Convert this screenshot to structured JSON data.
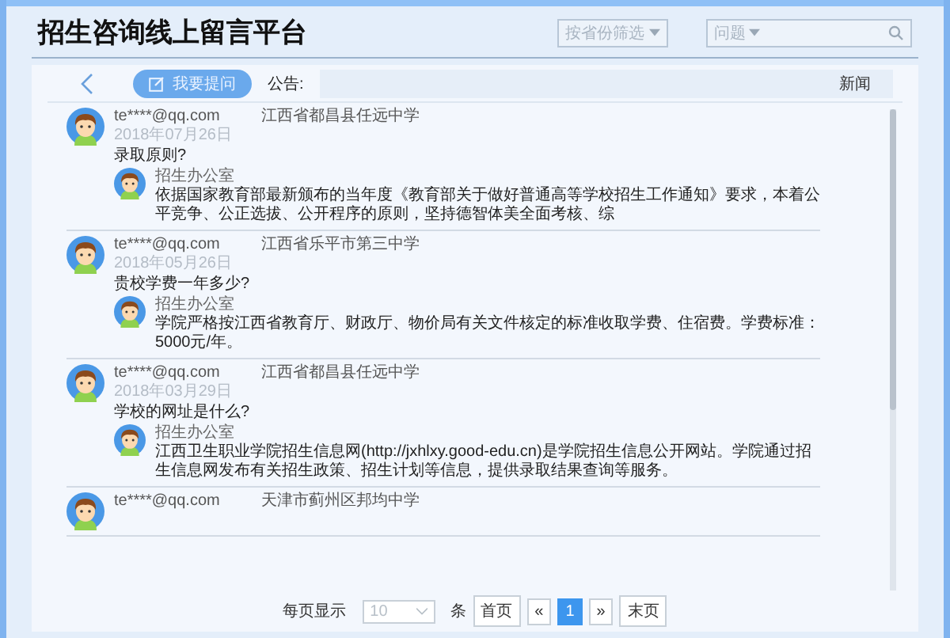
{
  "header": {
    "title": "招生咨询线上留言平台",
    "filter": {
      "value": "按省份筛选"
    },
    "search": {
      "category": "问题"
    }
  },
  "toolbar": {
    "ask_button": "我要提问",
    "notice_label": "公告:",
    "notice_text": "新闻"
  },
  "messages": [
    {
      "email": "te****@qq.com",
      "school": "江西省都昌县任远中学",
      "date": "2018年07月26日",
      "question": "录取原则?",
      "reply": {
        "author": "招生办公室",
        "text": "依据国家教育部最新颁布的当年度《教育部关于做好普通高等学校招生工作通知》要求，本着公平竞争、公正选拔、公开程序的原则，坚持德智体美全面考核、综"
      }
    },
    {
      "email": "te****@qq.com",
      "school": "江西省乐平市第三中学",
      "date": "2018年05月26日",
      "question": "贵校学费一年多少?",
      "reply": {
        "author": "招生办公室",
        "text": "学院严格按江西省教育厅、财政厅、物价局有关文件核定的标准收取学费、住宿费。学费标准：5000元/年。"
      }
    },
    {
      "email": "te****@qq.com",
      "school": "江西省都昌县任远中学",
      "date": "2018年03月29日",
      "question": "学校的网址是什么?",
      "reply": {
        "author": "招生办公室",
        "text": "江西卫生职业学院招生信息网(http://jxhlxy.good-edu.cn)是学院招生信息公开网站。学院通过招生信息网发布有关招生政策、招生计划等信息，提供录取结果查询等服务。"
      }
    },
    {
      "email": "te****@qq.com",
      "school": "天津市蓟州区邦均中学"
    }
  ],
  "pagination": {
    "per_page_label": "每页显示",
    "per_page": "10",
    "unit": "条",
    "buttons": [
      {
        "label": "首页",
        "selected": false
      },
      {
        "label": "«",
        "selected": false
      },
      {
        "label": "1",
        "selected": true
      },
      {
        "label": "»",
        "selected": false
      },
      {
        "label": "末页",
        "selected": false
      }
    ]
  }
}
